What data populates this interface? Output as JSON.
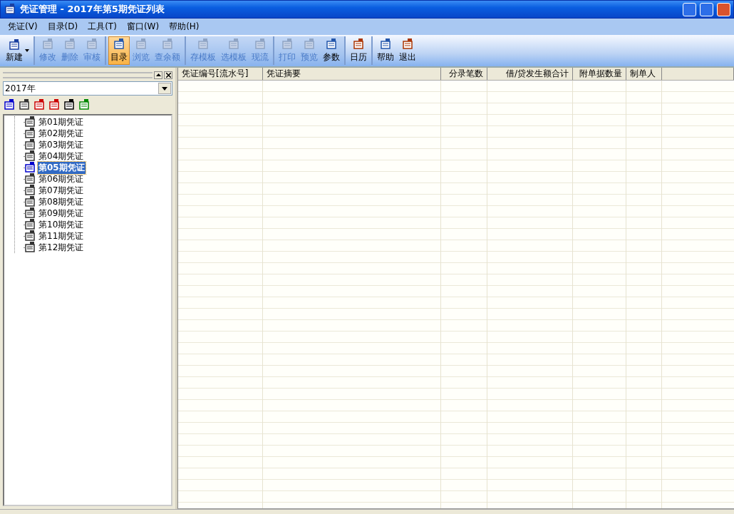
{
  "window": {
    "title": "凭证管理 - 2017年第5期凭证列表"
  },
  "menu": [
    "凭证(V)",
    "目录(D)",
    "工具(T)",
    "窗口(W)",
    "帮助(H)"
  ],
  "toolbar": [
    {
      "buttons": [
        {
          "label": "新建",
          "kind": "dropdown",
          "disabled": false,
          "selected": false
        }
      ]
    },
    {
      "buttons": [
        {
          "label": "修改",
          "kind": "button",
          "disabled": true,
          "selected": false
        },
        {
          "label": "删除",
          "kind": "button",
          "disabled": true,
          "selected": false
        },
        {
          "label": "审核",
          "kind": "button",
          "disabled": true,
          "selected": false
        }
      ]
    },
    {
      "buttons": [
        {
          "label": "目录",
          "kind": "button",
          "disabled": false,
          "selected": true
        },
        {
          "label": "浏览",
          "kind": "button",
          "disabled": true,
          "selected": false
        },
        {
          "label": "查余额",
          "kind": "button",
          "disabled": true,
          "selected": false
        }
      ]
    },
    {
      "buttons": [
        {
          "label": "存模板",
          "kind": "button",
          "disabled": true,
          "selected": false
        },
        {
          "label": "选模板",
          "kind": "button",
          "disabled": true,
          "selected": false
        },
        {
          "label": "现流",
          "kind": "button",
          "disabled": true,
          "selected": false
        }
      ]
    },
    {
      "buttons": [
        {
          "label": "打印",
          "kind": "button",
          "disabled": true,
          "selected": false
        },
        {
          "label": "预览",
          "kind": "button",
          "disabled": true,
          "selected": false
        },
        {
          "label": "参数",
          "kind": "button",
          "disabled": false,
          "selected": false
        }
      ]
    },
    {
      "buttons": [
        {
          "label": "日历",
          "kind": "button",
          "disabled": false,
          "selected": false
        }
      ]
    },
    {
      "buttons": [
        {
          "label": "帮助",
          "kind": "button",
          "disabled": false,
          "selected": false
        },
        {
          "label": "退出",
          "kind": "button",
          "disabled": false,
          "selected": false
        }
      ]
    }
  ],
  "sidebar": {
    "year": "2017年",
    "items": [
      {
        "label": "第01期凭证",
        "selected": false
      },
      {
        "label": "第02期凭证",
        "selected": false
      },
      {
        "label": "第03期凭证",
        "selected": false
      },
      {
        "label": "第04期凭证",
        "selected": false
      },
      {
        "label": "第05期凭证",
        "selected": true
      },
      {
        "label": "第06期凭证",
        "selected": false
      },
      {
        "label": "第07期凭证",
        "selected": false
      },
      {
        "label": "第08期凭证",
        "selected": false
      },
      {
        "label": "第09期凭证",
        "selected": false
      },
      {
        "label": "第10期凭证",
        "selected": false
      },
      {
        "label": "第11期凭证",
        "selected": false
      },
      {
        "label": "第12期凭证",
        "selected": false
      }
    ]
  },
  "table": {
    "columns": [
      "凭证编号[流水号]",
      "凭证摘要",
      "分录笔数",
      "借/贷发生额合计",
      "附单据数量",
      "制单人"
    ]
  }
}
